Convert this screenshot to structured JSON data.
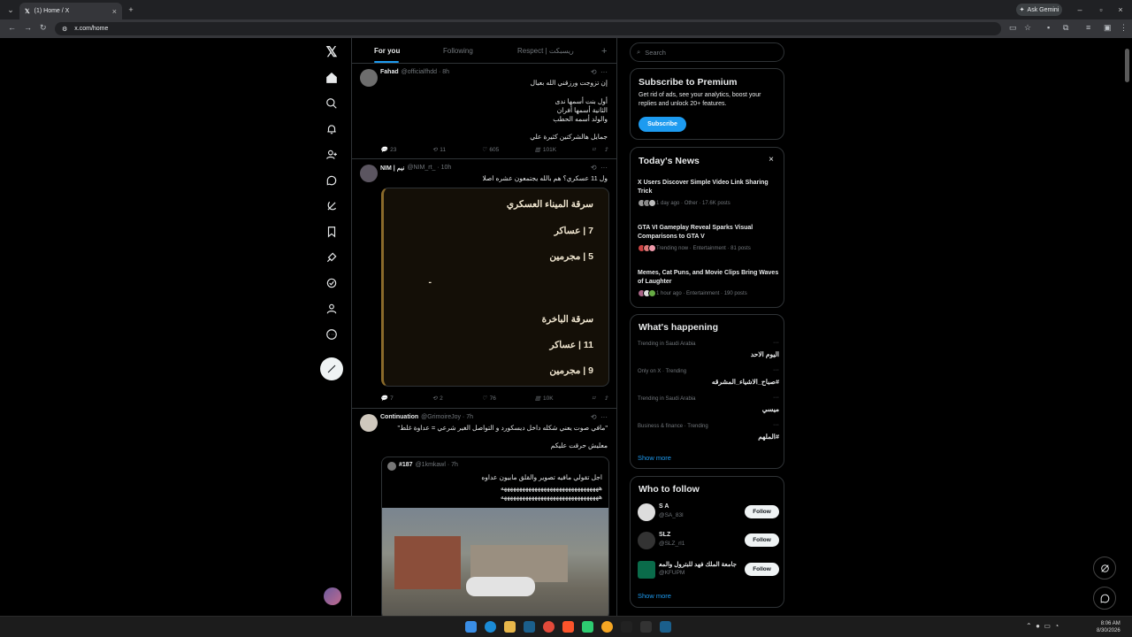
{
  "browser": {
    "tab_title": "(1) Home / X",
    "url": "x.com/home",
    "ask_gemini": "Ask Gemini"
  },
  "feed_tabs": [
    "For you",
    "Following",
    "Respect | ريسبكت"
  ],
  "posts": [
    {
      "name": "Fahad",
      "handle": "@officialfhdd · 8h",
      "lines": [
        "إن تزوجت ورزقني الله بعيال",
        "أول بنت أسمها ندى",
        "الثانية أسمها أفران",
        "والولد أسمه الحطب",
        "جمايل هالشركتين كثيرة علي"
      ],
      "replies": "23",
      "reposts": "11",
      "likes": "605",
      "views": "101K"
    },
    {
      "name": "NIM | نيم",
      "handle": "@NIM_rt_ · 10h",
      "text": "ول 11 عسكري؟ هم بالله يجتمعون عشره اصلا",
      "image_lines": [
        "سرقة الميناء العسكري",
        "7 | عساكر",
        "5 | مجرمين",
        "-",
        "سرقة الباخرة",
        "11 | عساكر",
        "9 | مجرمين"
      ],
      "replies": "7",
      "reposts": "2",
      "likes": "76",
      "views": "10K"
    },
    {
      "name": "Continuation",
      "handle": "@GrimoireJoy · 7h",
      "text": "\"مافي صوت يعني شكله داخل ديسكورد و التواصل الغير شرعي = عداوة غلط\"",
      "text2": "معليش حرقت عليكم",
      "quote": {
        "name": "#187",
        "handle": "@1kmkawl · 7h",
        "line1": "اجل تقولي مافيه تصوير والقلق مابيون عداوه",
        "line2": "ههههههههههههههههههههههههههههههههه",
        "line3": "ههههههههههههههههههههههههههههههههه"
      }
    }
  ],
  "search_placeholder": "Search",
  "premium": {
    "title": "Subscribe to Premium",
    "body": "Get rid of ads, see your analytics, boost your replies and unlock 20+ features.",
    "button": "Subscribe"
  },
  "news": {
    "title": "Today's News",
    "items": [
      {
        "title": "X Users Discover Simple Video Link Sharing Trick",
        "meta": "1 day ago · Other · 17.6K posts"
      },
      {
        "title": "GTA VI Gameplay Reveal Sparks Visual Comparisons to GTA V",
        "meta": "Trending now · Entertainment · 81 posts"
      },
      {
        "title": "Memes, Cat Puns, and Movie Clips Bring Waves of Laughter",
        "meta": "1 hour ago · Entertainment · 190 posts"
      }
    ]
  },
  "happening": {
    "title": "What's happening",
    "items": [
      {
        "context": "Trending in Saudi Arabia",
        "name": "اليوم الاحد"
      },
      {
        "context": "Only on X · Trending",
        "name": "#صباح_الاشياء_المشرقه"
      },
      {
        "context": "Trending in Saudi Arabia",
        "name": "ميسي"
      },
      {
        "context": "Business & finance · Trending",
        "name": "#الملهم"
      }
    ],
    "show_more": "Show more"
  },
  "who_to_follow": {
    "title": "Who to follow",
    "items": [
      {
        "name": "S A",
        "handle": "@SA_83l",
        "button": "Follow"
      },
      {
        "name": "SLZ",
        "handle": "@SLZ_rl1",
        "button": "Follow"
      },
      {
        "name": "جامعة الملك فهد للبترول والمعادن",
        "handle": "@KFUPM",
        "button": "Follow"
      }
    ],
    "show_more": "Show more"
  },
  "clock": {
    "time": "8:06 AM",
    "date": "8/30/2026"
  },
  "colors": {
    "accent": "#1d9bf0",
    "background": "#000000",
    "border": "#2f3336"
  }
}
